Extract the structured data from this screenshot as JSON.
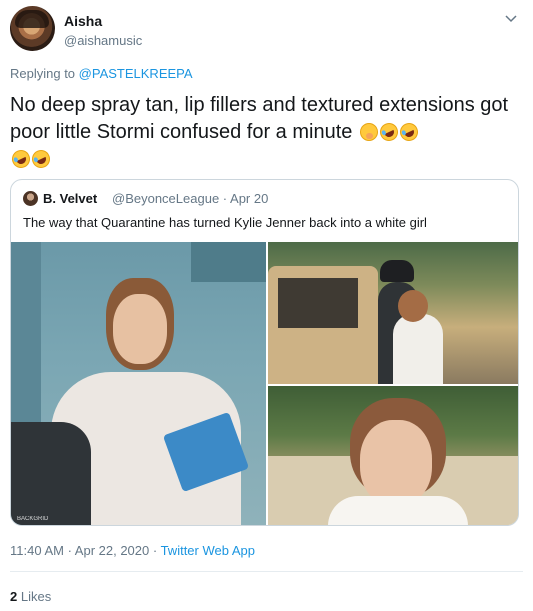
{
  "author": {
    "name": "Aisha",
    "handle": "@aishamusic"
  },
  "reply": {
    "prefix": "Replying to",
    "target": "@PASTELKREEPA"
  },
  "tweet": {
    "text": "No deep spray tan, lip fillers and textured extensions got poor little Stormi confused for a minute",
    "emojis": [
      "shushing-face",
      "rolling-on-floor-laughing",
      "rolling-on-floor-laughing",
      "rolling-on-floor-laughing",
      "rolling-on-floor-laughing"
    ]
  },
  "quote": {
    "name": "B. Velvet",
    "handle": "@BeyonceLeague",
    "date": "· Apr 20",
    "text": "The way that Quarantine has turned Kylie Jenner back into a white girl",
    "photo_credit": "BACKGRID"
  },
  "meta": {
    "timestamp": "11:40 AM · Apr 22, 2020 ·",
    "source": "Twitter Web App"
  },
  "stats": {
    "likes_count": "2",
    "likes_label": "Likes"
  },
  "colors": {
    "link": "#1b95e0",
    "secondary": "#657786",
    "text": "#14171a",
    "border": "#ccd6dd"
  }
}
